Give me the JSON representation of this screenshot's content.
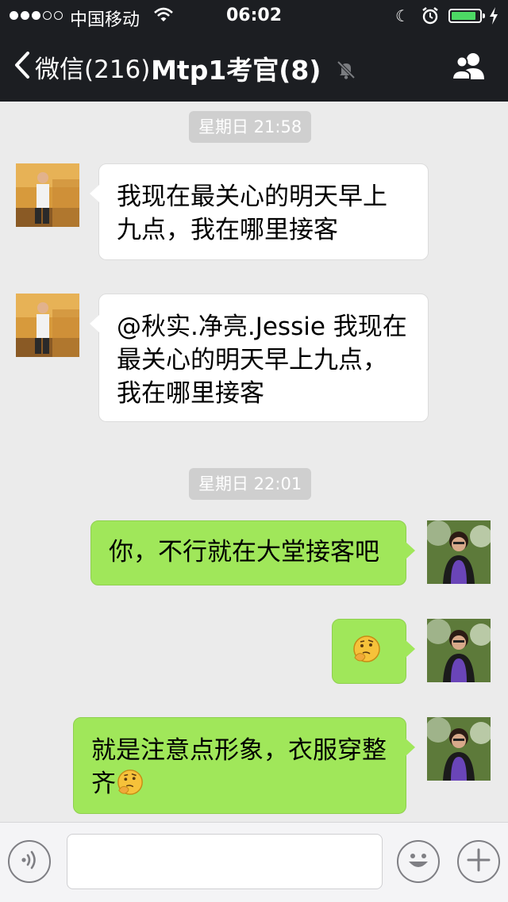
{
  "status_bar": {
    "carrier": "中国移动",
    "time": "06:02"
  },
  "nav": {
    "back_label": "微信(216)",
    "title": "Mtp1考官(8)",
    "icons": [
      "chevron-left-icon",
      "mute-bell-icon",
      "group-members-icon"
    ]
  },
  "chat": {
    "timestamps": [
      "星期日 21:58",
      "星期日 22:01"
    ],
    "messages": [
      {
        "sender": "other",
        "text": "我现在最关心的明天早上九点，我在哪里接客"
      },
      {
        "sender": "other",
        "text": "@秋实.净亮.Jessie 我现在最关心的明天早上九点，我在哪里接客"
      },
      {
        "sender": "self",
        "text": "你，不行就在大堂接客吧"
      },
      {
        "sender": "self",
        "emoji": "thinking-face-emoji"
      },
      {
        "sender": "self",
        "text": "就是注意点形象，衣服穿整齐",
        "emoji": "thinking-face-emoji"
      }
    ]
  },
  "input_bar": {
    "placeholder": "",
    "icons": [
      "voice-icon",
      "smiley-icon",
      "plus-icon"
    ]
  },
  "colors": {
    "nav_bg": "#1c1e22",
    "chat_bg": "#ebebeb",
    "outgoing_bubble": "#a0e75a",
    "incoming_bubble": "#ffffff",
    "battery_green": "#4cd964"
  }
}
